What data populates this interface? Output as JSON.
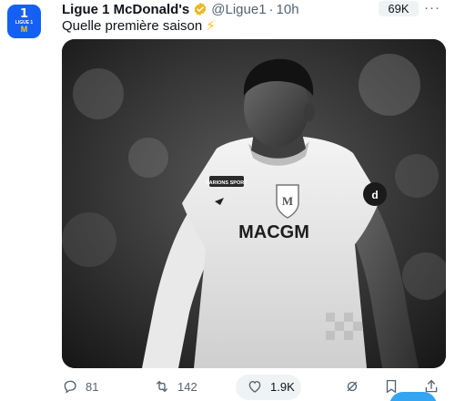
{
  "tweet": {
    "display_name": "Ligue 1 McDonald's",
    "handle": "@Ligue1",
    "separator": "·",
    "time": "10h",
    "views_badge": "69K",
    "more": "···",
    "text": "Quelle première saison",
    "emoji": "⚡"
  },
  "avatar": {
    "mark": "1",
    "label": "LIGUE 1",
    "sponsor": "M",
    "bg_color": "#1460f5"
  },
  "media": {
    "jersey_sponsor": "MACGM",
    "badge_sponsor": "PARIONS SPORT"
  },
  "actions": {
    "replies": "81",
    "reposts": "142",
    "likes": "1.9K"
  },
  "colors": {
    "text": "#0f1419",
    "secondary": "#536471",
    "verified": "#e8b923",
    "accent": "#1d9bf0"
  }
}
